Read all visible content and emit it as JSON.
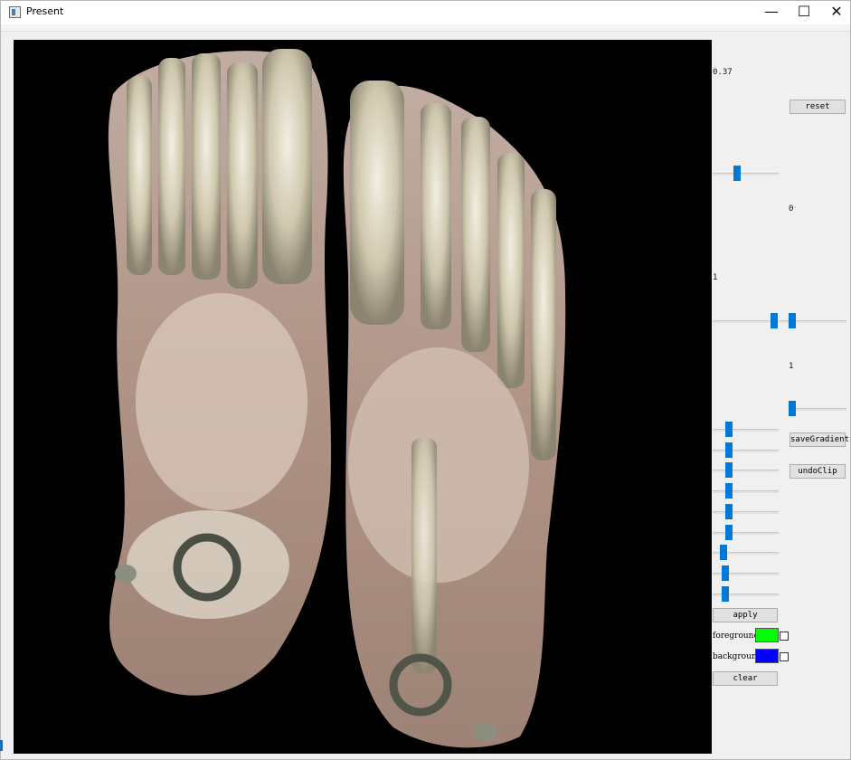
{
  "window": {
    "title": "Present",
    "minimize_glyph": "—",
    "maximize_glyph": "☐",
    "close_glyph": "✕"
  },
  "viewport": {
    "description_icon": "volume-render-feet"
  },
  "panel": {
    "opacity_value": "0.37",
    "reset_label": "reset",
    "slider1_value": 0.35,
    "value_zero": "0",
    "value_one_a": "1",
    "range_slider_low": 0.92,
    "range_slider_high": 1.0,
    "value_one_b": "1",
    "slider3_value": 1.0,
    "save_gradient_label": "saveGradient",
    "undo_clip_label": "undoClip",
    "clip_sliders": [
      0.22,
      0.22,
      0.22,
      0.22,
      0.22,
      0.22,
      0.12,
      0.15,
      0.15
    ],
    "apply_label": "apply",
    "foreground_label": "foreground",
    "foreground_color": "#00ff00",
    "background_label": "background",
    "background_color": "#0000ff",
    "clear_label": "clear"
  }
}
